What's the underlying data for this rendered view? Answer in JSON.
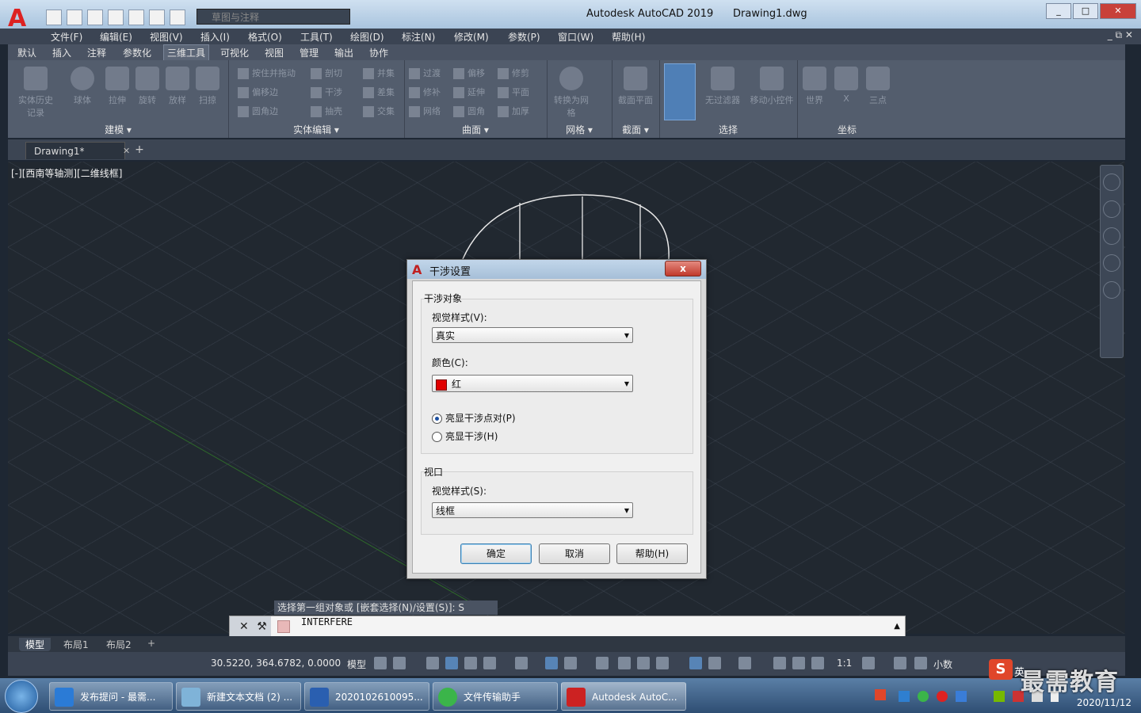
{
  "window": {
    "app_title": "Autodesk AutoCAD 2019",
    "doc_title": "Drawing1.dwg",
    "workspace": "草图与注释"
  },
  "menu": [
    "文件(F)",
    "编辑(E)",
    "视图(V)",
    "插入(I)",
    "格式(O)",
    "工具(T)",
    "绘图(D)",
    "标注(N)",
    "修改(M)",
    "参数(P)",
    "窗口(W)",
    "帮助(H)"
  ],
  "ribbon": {
    "tabs": [
      "默认",
      "插入",
      "注释",
      "参数化",
      "三维工具",
      "可视化",
      "视图",
      "管理",
      "输出",
      "协作"
    ],
    "active_tab": "三维工具",
    "panels": {
      "modeling": {
        "title": "建模",
        "buttons": [
          "实体历史记录",
          "球体",
          "拉伸",
          "旋转",
          "放样",
          "扫掠"
        ]
      },
      "solid_edit": {
        "title": "实体编辑",
        "buttons": [
          "按住并拖动",
          "剖切",
          "并集",
          "偏移边",
          "干涉",
          "差集",
          "圆角边",
          "抽壳",
          "交集"
        ]
      },
      "surface": {
        "title": "曲面",
        "buttons": [
          "过渡",
          "偏移",
          "修剪",
          "修补",
          "延伸",
          "平面",
          "网络",
          "圆角",
          "加厚"
        ]
      },
      "mesh": {
        "title": "网格",
        "buttons": [
          "转换为网格"
        ]
      },
      "section": {
        "title": "截面",
        "buttons": [
          "截面平面"
        ]
      },
      "selection": {
        "title": "选择",
        "buttons": [
          "无过滤器",
          "移动小控件"
        ]
      },
      "coordinates": {
        "title": "坐标",
        "buttons": [
          "世界",
          "X",
          "三点"
        ]
      }
    }
  },
  "file_tab": {
    "label": "Drawing1*"
  },
  "viewport": {
    "label": "[-][西南等轴测][二维线框]"
  },
  "command": {
    "prompt": "选择第一组对象或 [嵌套选择(N)/设置(S)]: S",
    "input": "INTERFERE"
  },
  "layout_tabs": [
    "模型",
    "布局1",
    "布局2"
  ],
  "status": {
    "coords": "30.5220, 364.6782, 0.0000",
    "model": "模型",
    "scale": "1:1",
    "units": "小数"
  },
  "dialog": {
    "title": "干涉设置",
    "group1_title": "干涉对象",
    "visual_style_label": "视觉样式(V):",
    "visual_style_value": "真实",
    "color_label": "颜色(C):",
    "color_value": "红",
    "color_swatch": "#e00000",
    "radio_pair": "亮显干涉点对(P)",
    "radio_interf": "亮显干涉(H)",
    "selected_radio": "亮显干涉点对(P)",
    "group2_title": "视口",
    "vp_style_label": "视觉样式(S):",
    "vp_style_value": "线框",
    "ok": "确定",
    "cancel": "取消",
    "help": "帮助(H)",
    "close": "x"
  },
  "taskbar": {
    "items": [
      "发布提问 - 最需...",
      "新建文本文档 (2) ...",
      "2020102610095...",
      "文件传输助手",
      "Autodesk AutoC..."
    ],
    "date": "2020/11/12",
    "ime": "英",
    "watermark": "最需教育"
  },
  "colors": {
    "accent_red": "#d22020",
    "ucs_axis": "#2e6a2a",
    "canvas": "#212830"
  }
}
